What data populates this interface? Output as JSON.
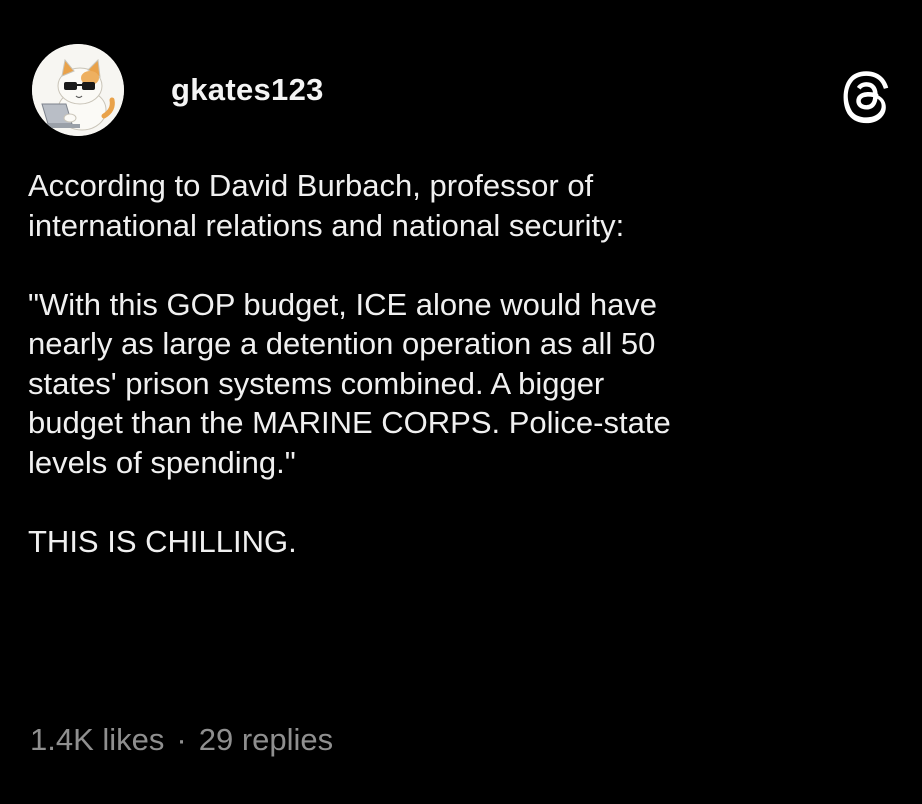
{
  "post": {
    "username": "gkates123",
    "avatar_icon": "cat-with-sunglasses-laptop-avatar",
    "platform_icon": "threads-logo-icon",
    "paragraphs": [
      "According to David Burbach, professor of\ninternational relations and national security:",
      "\"With this GOP budget, ICE alone would have\nnearly as large a detention operation as all 50\nstates' prison systems combined.  A bigger\nbudget than the MARINE CORPS. Police-state\nlevels of spending.\"",
      "THIS IS CHILLING."
    ],
    "likes": "1.4K likes",
    "separator": "·",
    "replies": "29 replies"
  },
  "colors": {
    "background": "#000000",
    "text": "#f0f0f0",
    "muted": "#8f8f8f"
  }
}
